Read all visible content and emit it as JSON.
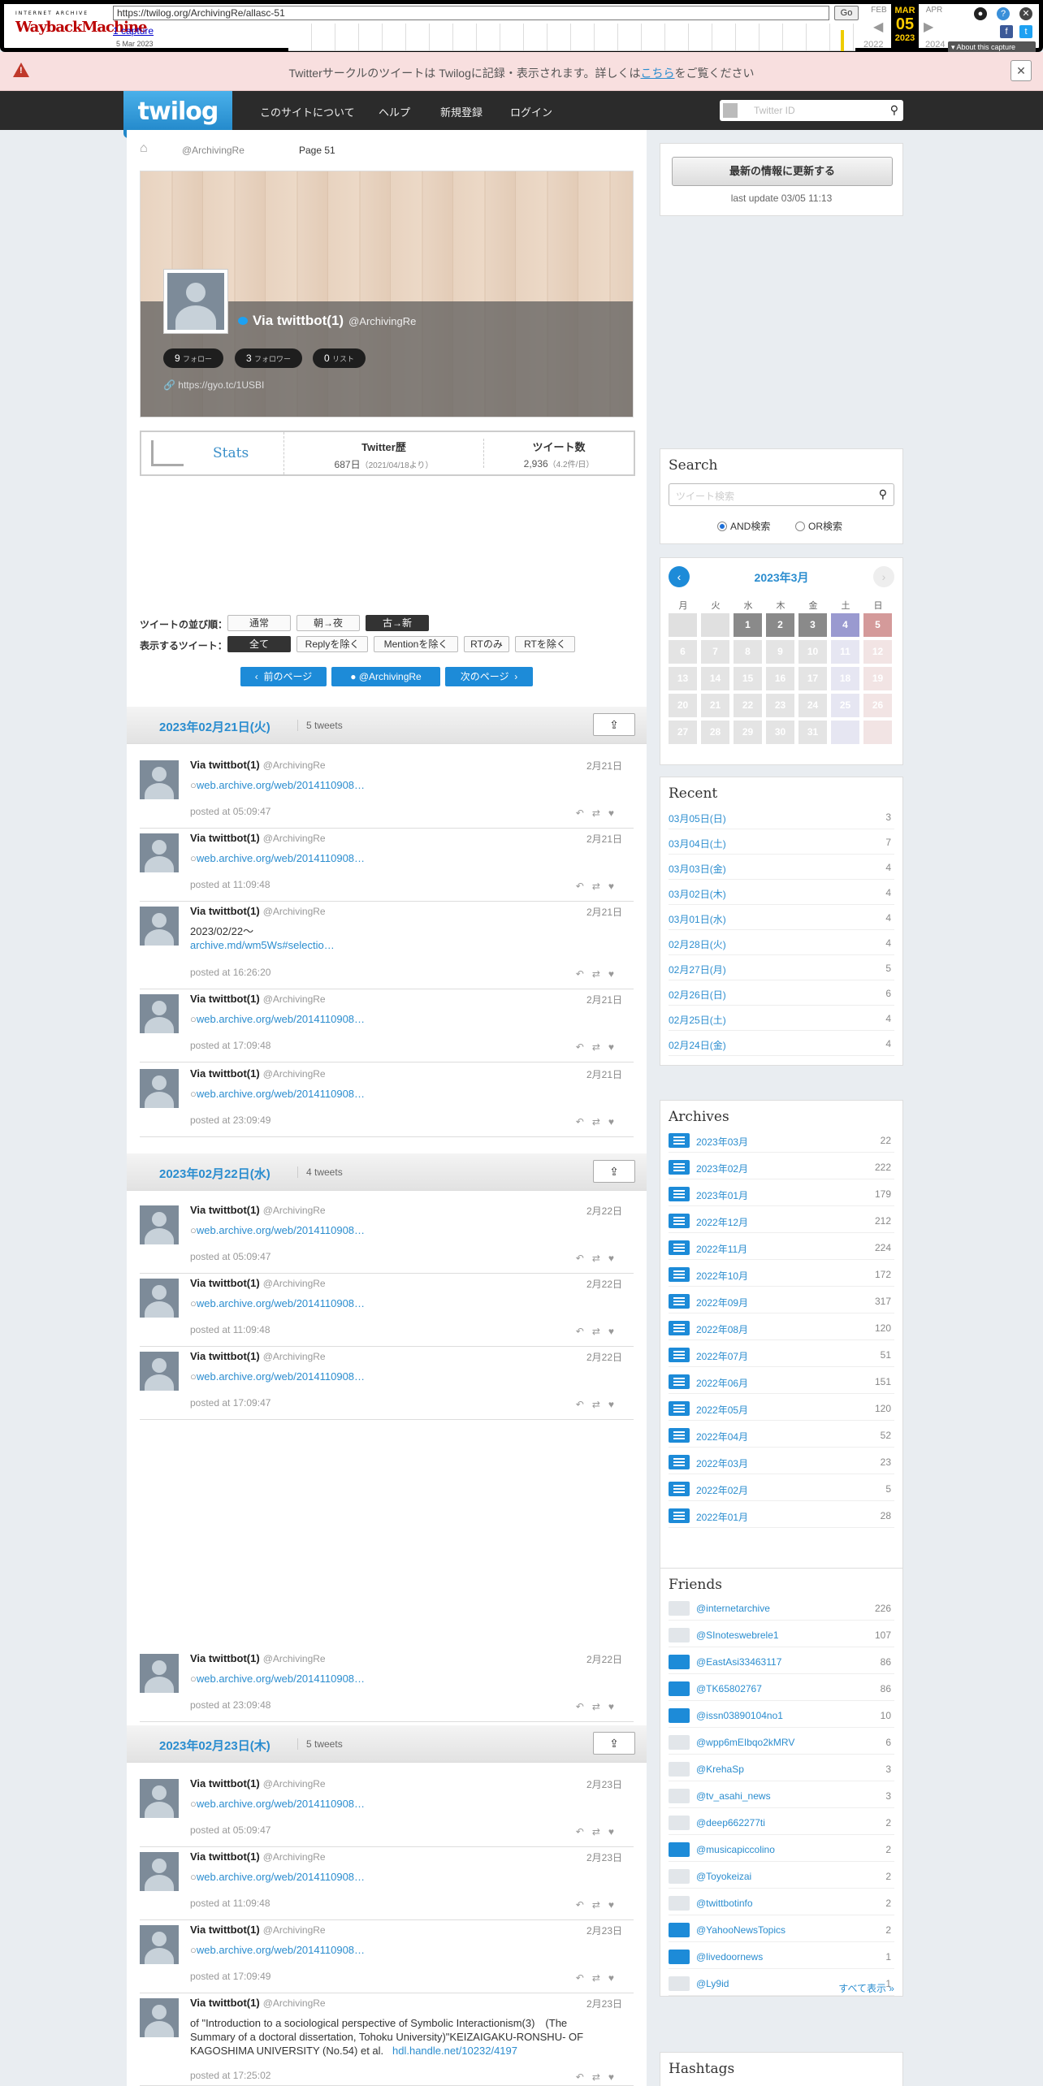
{
  "wayback": {
    "logo_top": "INTERNET ARCHIVE",
    "logo_main": "WaybackMachine",
    "url": "https://twilog.org/ArchivingRe/allasc-51",
    "go": "Go",
    "captures": "1 capture",
    "capture_date": "5 Mar 2023",
    "prev_month": "FEB",
    "cur_month": "MAR",
    "cur_day": "05",
    "cur_year": "2023",
    "next_month": "APR",
    "prev_year": "2022",
    "next_year": "2024",
    "about": "▾ About this capture"
  },
  "notice": {
    "text_before": "Twitterサークルのツイートは Twilogに記録・表示されます。詳しくは",
    "link": "こちら",
    "text_after": "をご覧ください",
    "close": "✕"
  },
  "nav": {
    "brand": "twilog",
    "items": [
      "このサイトについて",
      "ヘルプ",
      "新規登録",
      "ログイン"
    ],
    "search_placeholder": "Twitter ID"
  },
  "breadcrumb": {
    "user": "@ArchivingRe",
    "page": "Page 51"
  },
  "profile": {
    "name": "Via twittbot(1)",
    "handle": "@ArchivingRe",
    "follow": "9",
    "follow_label": "フォロー",
    "follower": "3",
    "follower_label": "フォロワー",
    "list": "0",
    "list_label": "リスト",
    "site": "https://gyo.tc/1USBI"
  },
  "stats": {
    "label": "Stats",
    "history_title": "Twitter歴",
    "history_value": "687日",
    "history_note": "（2021/04/18より）",
    "tweets_title": "ツイート数",
    "tweets_value": "2,936",
    "tweets_note": "（4.2件/日）"
  },
  "options": {
    "order_label": "ツイートの並び順：",
    "order": [
      "通常",
      "朝→夜",
      "古→新"
    ],
    "show_label": "表示するツイート：",
    "show": [
      "全て",
      "Replyを除く",
      "Mentionを除く",
      "RTのみ",
      "RTを除く"
    ]
  },
  "pager": {
    "prev": "前のページ",
    "user": "@ArchivingRe",
    "next": "次のページ"
  },
  "days": [
    {
      "date": "2023年02月21日(火)",
      "count": "5 tweets"
    },
    {
      "date": "2023年02月22日(水)",
      "count": "4 tweets"
    },
    {
      "date": "2023年02月23日(木)",
      "count": "5 tweets"
    }
  ],
  "tweet_author": "Via twittbot(1)",
  "tweet_handle": "@ArchivingRe",
  "tweets": [
    {
      "date": "2月21日",
      "text": "web.archive.org/web/2014110908…",
      "time": "posted at 05:09:47"
    },
    {
      "date": "2月21日",
      "text": "web.archive.org/web/2014110908…",
      "time": "posted at 11:09:48"
    },
    {
      "date": "2月21日",
      "line1": "2023/02/22～",
      "text": "archive.md/wm5Ws#selectio…",
      "time": "posted at 16:26:20"
    },
    {
      "date": "2月21日",
      "text": "web.archive.org/web/2014110908…",
      "time": "posted at 17:09:48"
    },
    {
      "date": "2月21日",
      "text": "web.archive.org/web/2014110908…",
      "time": "posted at 23:09:49"
    },
    {
      "date": "2月22日",
      "text": "web.archive.org/web/2014110908…",
      "time": "posted at 05:09:47"
    },
    {
      "date": "2月22日",
      "text": "web.archive.org/web/2014110908…",
      "time": "posted at 11:09:48"
    },
    {
      "date": "2月22日",
      "text": "web.archive.org/web/2014110908…",
      "time": "posted at 17:09:47"
    },
    {
      "date": "2月22日",
      "text": "web.archive.org/web/2014110908…",
      "time": "posted at 23:09:48"
    },
    {
      "date": "2月23日",
      "text": "web.archive.org/web/2014110908…",
      "time": "posted at 05:09:47"
    },
    {
      "date": "2月23日",
      "text": "web.archive.org/web/2014110908…",
      "time": "posted at 11:09:48"
    },
    {
      "date": "2月23日",
      "text": "web.archive.org/web/2014110908…",
      "time": "posted at 17:09:49"
    },
    {
      "date": "2月23日",
      "long": "of \"Introduction to a sociological perspective of Symbolic Interactionism(3)　(The Summary of a doctoral dissertation, Tohoku University)\"KEIZAIGAKU-RONSHU- OF KAGOSHIMA UNIVERSITY (No.54) et al.",
      "text": "hdl.handle.net/10232/4197",
      "time": "posted at 17:25:02"
    }
  ],
  "side": {
    "update_btn": "最新の情報に更新する",
    "last_update": "last update 03/05 11:13",
    "search_title": "Search",
    "search_placeholder": "ツイート検索",
    "and": "AND検索",
    "or": "OR検索",
    "cal_title": "2023年3月",
    "cal_days": [
      "月",
      "火",
      "水",
      "木",
      "金",
      "土",
      "日"
    ],
    "recent_title": "Recent",
    "recent": [
      {
        "label": "03月05日(日)",
        "count": "3"
      },
      {
        "label": "03月04日(土)",
        "count": "7"
      },
      {
        "label": "03月03日(金)",
        "count": "4"
      },
      {
        "label": "03月02日(木)",
        "count": "4"
      },
      {
        "label": "03月01日(水)",
        "count": "4"
      },
      {
        "label": "02月28日(火)",
        "count": "4"
      },
      {
        "label": "02月27日(月)",
        "count": "5"
      },
      {
        "label": "02月26日(日)",
        "count": "6"
      },
      {
        "label": "02月25日(土)",
        "count": "4"
      },
      {
        "label": "02月24日(金)",
        "count": "4"
      }
    ],
    "archives_title": "Archives",
    "archives": [
      {
        "label": "2023年03月",
        "count": "22"
      },
      {
        "label": "2023年02月",
        "count": "222"
      },
      {
        "label": "2023年01月",
        "count": "179"
      },
      {
        "label": "2022年12月",
        "count": "212"
      },
      {
        "label": "2022年11月",
        "count": "224"
      },
      {
        "label": "2022年10月",
        "count": "172"
      },
      {
        "label": "2022年09月",
        "count": "317"
      },
      {
        "label": "2022年08月",
        "count": "120"
      },
      {
        "label": "2022年07月",
        "count": "51"
      },
      {
        "label": "2022年06月",
        "count": "151"
      },
      {
        "label": "2022年05月",
        "count": "120"
      },
      {
        "label": "2022年04月",
        "count": "52"
      },
      {
        "label": "2022年03月",
        "count": "23"
      },
      {
        "label": "2022年02月",
        "count": "5"
      },
      {
        "label": "2022年01月",
        "count": "28"
      }
    ],
    "show_all": "すべて表示 »",
    "friends_title": "Friends",
    "friends": [
      {
        "label": "@internetarchive",
        "count": "226",
        "blue": false
      },
      {
        "label": "@SInoteswebrele1",
        "count": "107",
        "blue": false
      },
      {
        "label": "@EastAsi33463117",
        "count": "86",
        "blue": true
      },
      {
        "label": "@TK65802767",
        "count": "86",
        "blue": true
      },
      {
        "label": "@issn03890104no1",
        "count": "10",
        "blue": true
      },
      {
        "label": "@wpp6mEIbqo2kMRV",
        "count": "6",
        "blue": false
      },
      {
        "label": "@KrehaSp",
        "count": "3",
        "blue": false
      },
      {
        "label": "@tv_asahi_news",
        "count": "3",
        "blue": false
      },
      {
        "label": "@deep662277ti",
        "count": "2",
        "blue": false
      },
      {
        "label": "@musicapiccolino",
        "count": "2",
        "blue": true
      },
      {
        "label": "@Toyokeizai",
        "count": "2",
        "blue": false
      },
      {
        "label": "@twittbotinfo",
        "count": "2",
        "blue": false
      },
      {
        "label": "@YahooNewsTopics",
        "count": "2",
        "blue": true
      },
      {
        "label": "@livedoornews",
        "count": "1",
        "blue": true
      },
      {
        "label": "@Ly9id",
        "count": "1",
        "blue": false
      }
    ],
    "hashtags_title": "Hashtags"
  }
}
